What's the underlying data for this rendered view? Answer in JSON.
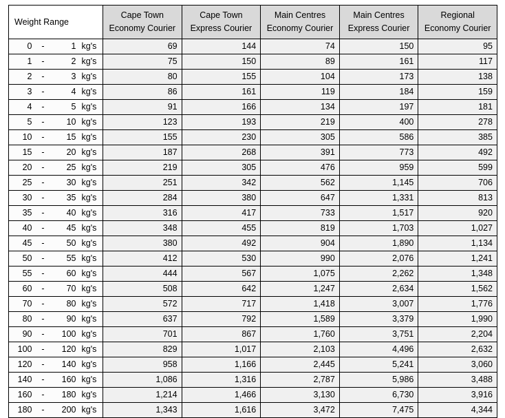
{
  "table": {
    "headers": {
      "weight_range": "Weight Range",
      "columns": [
        {
          "line1": "Cape Town",
          "line2": "Economy Courier"
        },
        {
          "line1": "Cape Town",
          "line2": "Express Courier"
        },
        {
          "line1": "Main Centres",
          "line2": "Economy Courier"
        },
        {
          "line1": "Main Centres",
          "line2": "Express Courier"
        },
        {
          "line1": "Regional",
          "line2": "Economy Courier"
        }
      ]
    },
    "unit_label": "kg's",
    "dash": "-",
    "rows": [
      {
        "min": "0",
        "dash": "-",
        "max": "1",
        "unit": "kg's",
        "values": [
          "69",
          "144",
          "74",
          "150",
          "95"
        ]
      },
      {
        "min": "1",
        "dash": "-",
        "max": "2",
        "unit": "kg's",
        "values": [
          "75",
          "150",
          "89",
          "161",
          "117"
        ]
      },
      {
        "min": "2",
        "dash": "-",
        "max": "3",
        "unit": "kg's",
        "values": [
          "80",
          "155",
          "104",
          "173",
          "138"
        ]
      },
      {
        "min": "3",
        "dash": "-",
        "max": "4",
        "unit": "kg's",
        "values": [
          "86",
          "161",
          "119",
          "184",
          "159"
        ]
      },
      {
        "min": "4",
        "dash": "-",
        "max": "5",
        "unit": "kg's",
        "values": [
          "91",
          "166",
          "134",
          "197",
          "181"
        ]
      },
      {
        "min": "5",
        "dash": "-",
        "max": "10",
        "unit": "kg's",
        "values": [
          "123",
          "193",
          "219",
          "400",
          "278"
        ]
      },
      {
        "min": "10",
        "dash": "-",
        "max": "15",
        "unit": "kg's",
        "values": [
          "155",
          "230",
          "305",
          "586",
          "385"
        ]
      },
      {
        "min": "15",
        "dash": "-",
        "max": "20",
        "unit": "kg's",
        "values": [
          "187",
          "268",
          "391",
          "773",
          "492"
        ]
      },
      {
        "min": "20",
        "dash": "-",
        "max": "25",
        "unit": "kg's",
        "values": [
          "219",
          "305",
          "476",
          "959",
          "599"
        ]
      },
      {
        "min": "25",
        "dash": "-",
        "max": "30",
        "unit": "kg's",
        "values": [
          "251",
          "342",
          "562",
          "1,145",
          "706"
        ]
      },
      {
        "min": "30",
        "dash": "-",
        "max": "35",
        "unit": "kg's",
        "values": [
          "284",
          "380",
          "647",
          "1,331",
          "813"
        ]
      },
      {
        "min": "35",
        "dash": "-",
        "max": "40",
        "unit": "kg's",
        "values": [
          "316",
          "417",
          "733",
          "1,517",
          "920"
        ]
      },
      {
        "min": "40",
        "dash": "-",
        "max": "45",
        "unit": "kg's",
        "values": [
          "348",
          "455",
          "819",
          "1,703",
          "1,027"
        ]
      },
      {
        "min": "45",
        "dash": "-",
        "max": "50",
        "unit": "kg's",
        "values": [
          "380",
          "492",
          "904",
          "1,890",
          "1,134"
        ]
      },
      {
        "min": "50",
        "dash": "-",
        "max": "55",
        "unit": "kg's",
        "values": [
          "412",
          "530",
          "990",
          "2,076",
          "1,241"
        ]
      },
      {
        "min": "55",
        "dash": "-",
        "max": "60",
        "unit": "kg's",
        "values": [
          "444",
          "567",
          "1,075",
          "2,262",
          "1,348"
        ]
      },
      {
        "min": "60",
        "dash": "-",
        "max": "70",
        "unit": "kg's",
        "values": [
          "508",
          "642",
          "1,247",
          "2,634",
          "1,562"
        ]
      },
      {
        "min": "70",
        "dash": "-",
        "max": "80",
        "unit": "kg's",
        "values": [
          "572",
          "717",
          "1,418",
          "3,007",
          "1,776"
        ]
      },
      {
        "min": "80",
        "dash": "-",
        "max": "90",
        "unit": "kg's",
        "values": [
          "637",
          "792",
          "1,589",
          "3,379",
          "1,990"
        ]
      },
      {
        "min": "90",
        "dash": "-",
        "max": "100",
        "unit": "kg's",
        "values": [
          "701",
          "867",
          "1,760",
          "3,751",
          "2,204"
        ]
      },
      {
        "min": "100",
        "dash": "-",
        "max": "120",
        "unit": "kg's",
        "values": [
          "829",
          "1,017",
          "2,103",
          "4,496",
          "2,632"
        ]
      },
      {
        "min": "120",
        "dash": "-",
        "max": "140",
        "unit": "kg's",
        "values": [
          "958",
          "1,166",
          "2,445",
          "5,241",
          "3,060"
        ]
      },
      {
        "min": "140",
        "dash": "-",
        "max": "160",
        "unit": "kg's",
        "values": [
          "1,086",
          "1,316",
          "2,787",
          "5,986",
          "3,488"
        ]
      },
      {
        "min": "160",
        "dash": "-",
        "max": "180",
        "unit": "kg's",
        "values": [
          "1,214",
          "1,466",
          "3,130",
          "6,730",
          "3,916"
        ]
      },
      {
        "min": "180",
        "dash": "-",
        "max": "200",
        "unit": "kg's",
        "values": [
          "1,343",
          "1,616",
          "3,472",
          "7,475",
          "4,344"
        ]
      }
    ]
  },
  "colors": {
    "header_background": "#d9d9d9",
    "weight_header_background": "#ffffff",
    "cell_background": "#f0f0f0",
    "weight_cell_background": "#fcfcfc",
    "border": "#000000",
    "text": "#000000",
    "page_background": "#ffffff"
  }
}
